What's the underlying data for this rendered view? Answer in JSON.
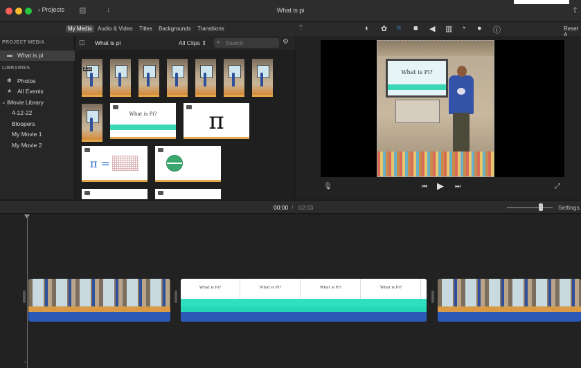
{
  "window": {
    "title": "What is pi",
    "projects_label": "Projects"
  },
  "browser_tabs": [
    "My Media",
    "Audio & Video",
    "Titles",
    "Backgrounds",
    "Transitions"
  ],
  "viewer_toolbar": {
    "reset_label": "Reset A"
  },
  "sidebar": {
    "project_media_header": "PROJECT MEDIA",
    "project_item": "What is pi",
    "libraries_header": "LIBRARIES",
    "items": [
      "Photos",
      "All Events",
      "iMovie Library",
      "4-12-22",
      "Bloopers",
      "My Movie 1",
      "My Movie 2"
    ]
  },
  "media_browser": {
    "title": "What is pi",
    "filter": "All Clips",
    "search_placeholder": "Search",
    "first_clip_badge": "2.3s",
    "slide_title_1": "What is Pi?",
    "pi_symbol": "π",
    "formula": "π ="
  },
  "preview": {
    "board_title": "What is Pi?"
  },
  "timeline": {
    "current_time": "00:00",
    "separator": "/",
    "total_time": "02:03",
    "settings_label": "Settings",
    "slide_titles": [
      "What is Pi?",
      "What is Pi?",
      "What is Pi?",
      "What is Pi?"
    ]
  },
  "icons": {
    "accent": "#3a8ee6"
  }
}
